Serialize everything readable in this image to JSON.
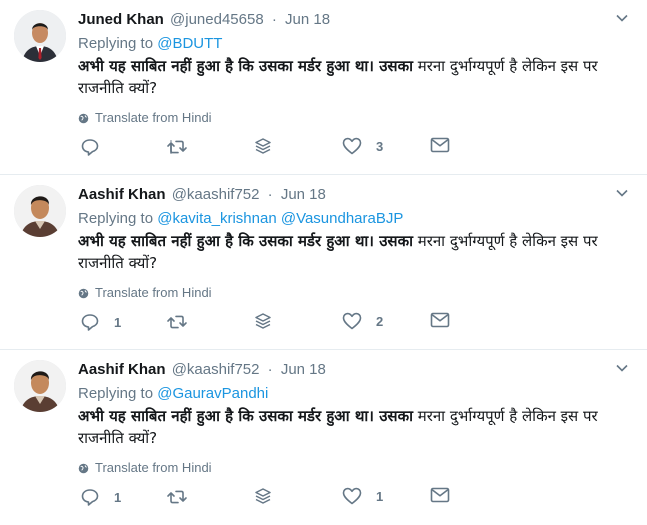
{
  "tweets": [
    {
      "name": "Juned Khan",
      "handle": "@juned45658",
      "time": "Jun 18",
      "replying_label": "Replying to",
      "mentions": [
        "@BDUTT"
      ],
      "text_bold": "अभी यह साबित नहीं हुआ है कि उसका मर्डर हुआ था। उसका",
      "text_normal": " मरना दुर्भाग्यपूर्ण है लेकिन इस पर राजनीति क्यों?",
      "translate": "Translate from Hindi",
      "reply_count": "",
      "retweet_count": "",
      "like_count": "3"
    },
    {
      "name": "Aashif Khan",
      "handle": "@kaashif752",
      "time": "Jun 18",
      "replying_label": "Replying to",
      "mentions": [
        "@kavita_krishnan",
        "@VasundharaBJP"
      ],
      "text_bold": "अभी यह साबित नहीं हुआ है कि उसका मर्डर हुआ था। उसका",
      "text_normal": " मरना दुर्भाग्यपूर्ण है लेकिन इस पर राजनीति क्यों?",
      "translate": "Translate from Hindi",
      "reply_count": "1",
      "retweet_count": "",
      "like_count": "2"
    },
    {
      "name": "Aashif Khan",
      "handle": "@kaashif752",
      "time": "Jun 18",
      "replying_label": "Replying to",
      "mentions": [
        "@GauravPandhi"
      ],
      "text_bold": "अभी यह साबित नहीं हुआ है कि उसका मर्डर हुआ था। उसका",
      "text_normal": " मरना दुर्भाग्यपूर्ण है लेकिन इस पर राजनीति क्यों?",
      "translate": "Translate from Hindi",
      "reply_count": "1",
      "retweet_count": "",
      "like_count": "1"
    }
  ],
  "colors": {
    "link": "#1b95e0",
    "muted": "#657786",
    "text": "#14171a",
    "divider": "#e6ecf0"
  }
}
